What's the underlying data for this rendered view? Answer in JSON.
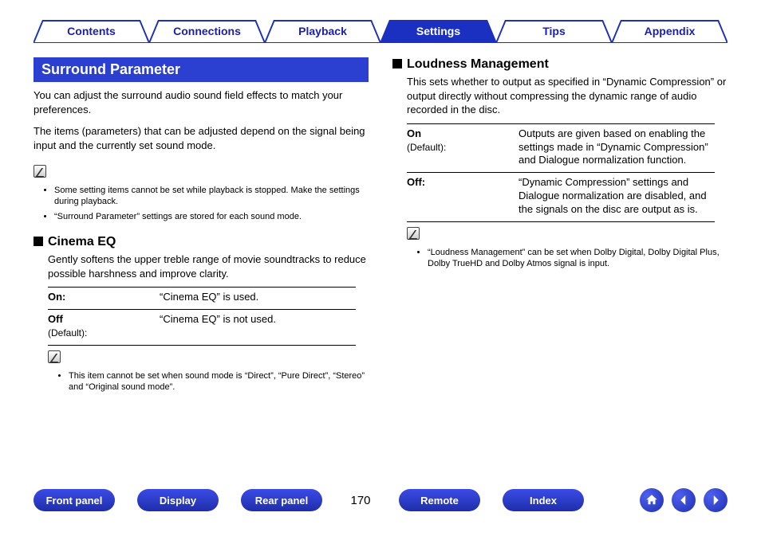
{
  "nav": {
    "tabs": [
      "Contents",
      "Connections",
      "Playback",
      "Settings",
      "Tips",
      "Appendix"
    ],
    "active": 3
  },
  "left": {
    "title": "Surround Parameter",
    "intro1": "You can adjust the surround audio sound field effects to match your preferences.",
    "intro2": "The items (parameters) that can be adjusted depend on the signal being input and the currently set sound mode.",
    "notes": [
      "Some setting items cannot be set while playback is stopped. Make the settings during playback.",
      "“Surround Parameter” settings are stored for each sound mode."
    ],
    "sub": {
      "title": "Cinema EQ",
      "desc": "Gently softens the upper treble range of movie soundtracks to reduce possible harshness and improve clarity.",
      "rows": [
        {
          "key": "On:",
          "default": "",
          "val": "“Cinema EQ” is used."
        },
        {
          "key": "Off",
          "default": "(Default):",
          "val": "“Cinema EQ” is not used."
        }
      ],
      "note": "This item cannot be set when sound mode is “Direct”, “Pure Direct”, “Stereo” and “Original sound mode”."
    }
  },
  "right": {
    "sub": {
      "title": "Loudness Management",
      "desc": "This sets whether to output as specified in “Dynamic Compression” or output directly without compressing the dynamic range of audio recorded in the disc.",
      "rows": [
        {
          "key": "On",
          "default": "(Default):",
          "val": "Outputs are given based on enabling the settings made in “Dynamic Compression” and Dialogue normalization function."
        },
        {
          "key": "Off:",
          "default": "",
          "val": "“Dynamic Compression” settings and Dialogue normalization are disabled, and the signals on the disc are output as is."
        }
      ],
      "note": "“Loudness Management” can be set when Dolby Digital, Dolby Digital Plus, Dolby TrueHD and Dolby Atmos signal is input."
    }
  },
  "footer": {
    "buttons": [
      "Front panel",
      "Display",
      "Rear panel"
    ],
    "page": "170",
    "buttons2": [
      "Remote",
      "Index"
    ]
  }
}
